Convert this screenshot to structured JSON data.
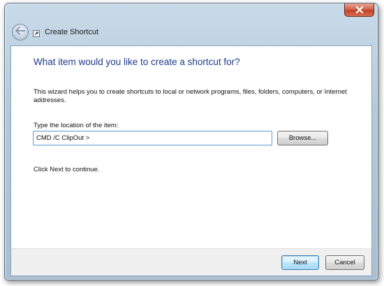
{
  "window": {
    "title": "Create Shortcut",
    "close_glyph": "x"
  },
  "content": {
    "heading": "What item would you like to create a shortcut for?",
    "description": "This wizard helps you to create shortcuts to local or network programs, files, folders, computers, or Internet addresses.",
    "location_label": "Type the location of the item:",
    "location_value": "CMD /C ClipOut >",
    "browse_label": "Browse...",
    "continue_text": "Click Next to continue."
  },
  "footer": {
    "next_label": "Next",
    "cancel_label": "Cancel"
  },
  "icons": {
    "back": "back-arrow-icon",
    "app": "shortcut-icon",
    "close": "close-icon"
  },
  "colors": {
    "heading": "#1e3a8a",
    "close_button": "#c2412a",
    "input_border": "#5b9bd5",
    "default_button_border": "#3c7fb1"
  }
}
